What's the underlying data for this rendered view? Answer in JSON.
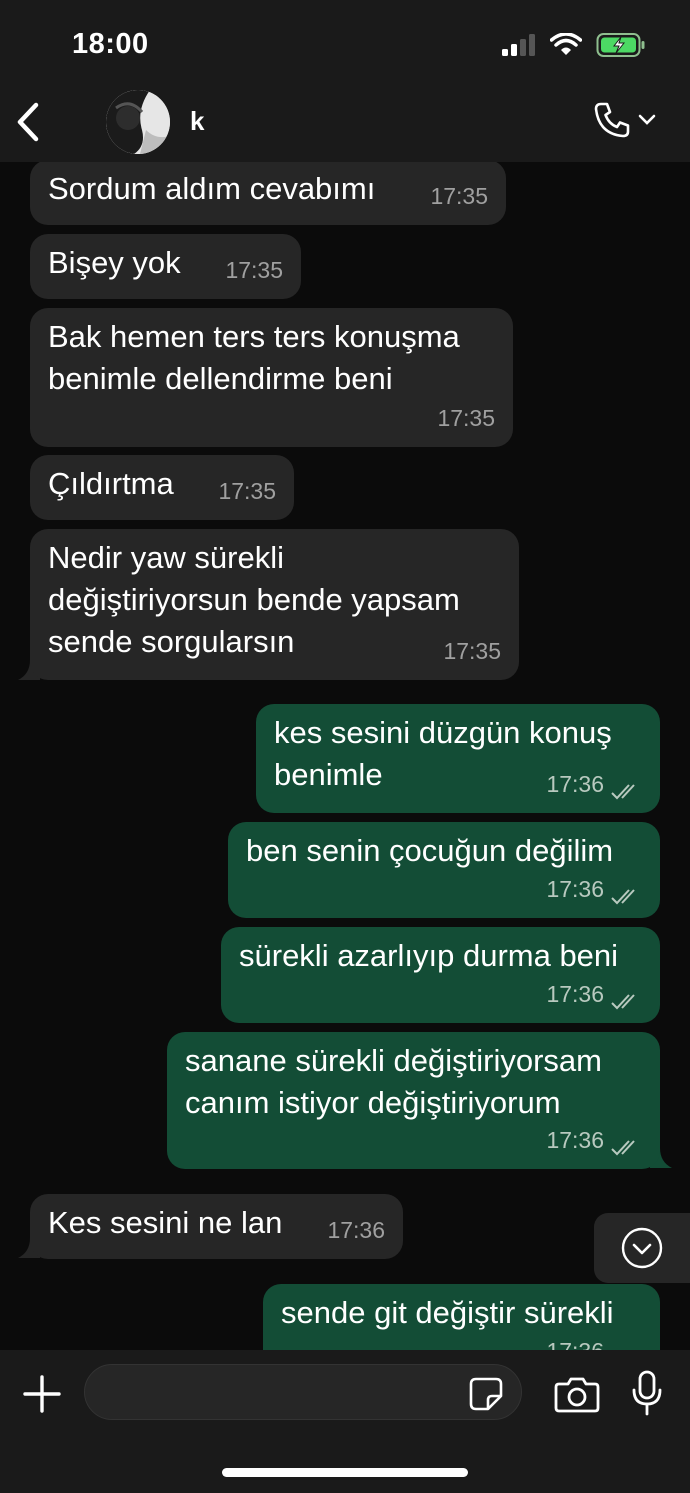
{
  "status": {
    "time": "18:00"
  },
  "header": {
    "contact_name": "k"
  },
  "messages": [
    {
      "dir": "in",
      "lines": [
        "Sordum aldım cevabımı"
      ],
      "time": "17:35"
    },
    {
      "dir": "in",
      "lines": [
        "Bişey yok"
      ],
      "time": "17:35"
    },
    {
      "dir": "in",
      "lines": [
        "Bak hemen ters ters konuşma",
        "benimle dellendirme beni"
      ],
      "time": "17:35"
    },
    {
      "dir": "in",
      "lines": [
        "Çıldırtma"
      ],
      "time": "17:35"
    },
    {
      "dir": "in",
      "lines": [
        "Nedir yaw sürekli",
        "değiştiriyorsun bende yapsam",
        "sende sorgularsın"
      ],
      "time": "17:35"
    },
    {
      "dir": "out",
      "lines": [
        "kes sesini düzgün konuş",
        "benimle"
      ],
      "time": "17:36"
    },
    {
      "dir": "out",
      "lines": [
        "ben senin çocuğun değilim"
      ],
      "time": "17:36"
    },
    {
      "dir": "out",
      "lines": [
        "sürekli azarlıyıp durma beni"
      ],
      "time": "17:36"
    },
    {
      "dir": "out",
      "lines": [
        "sanane sürekli değiştiriyorsam",
        "canım istiyor değiştiriyorum"
      ],
      "time": "17:36"
    },
    {
      "dir": "in",
      "lines": [
        "Kes sesini ne lan"
      ],
      "time": "17:36"
    },
    {
      "dir": "out",
      "lines": [
        "sende git değiştir sürekli"
      ],
      "time": "17:36"
    }
  ],
  "composer": {
    "value": "",
    "placeholder": ""
  },
  "colors": {
    "incoming": "#262626",
    "outgoing": "#134d36",
    "background": "#0b0b0b"
  }
}
